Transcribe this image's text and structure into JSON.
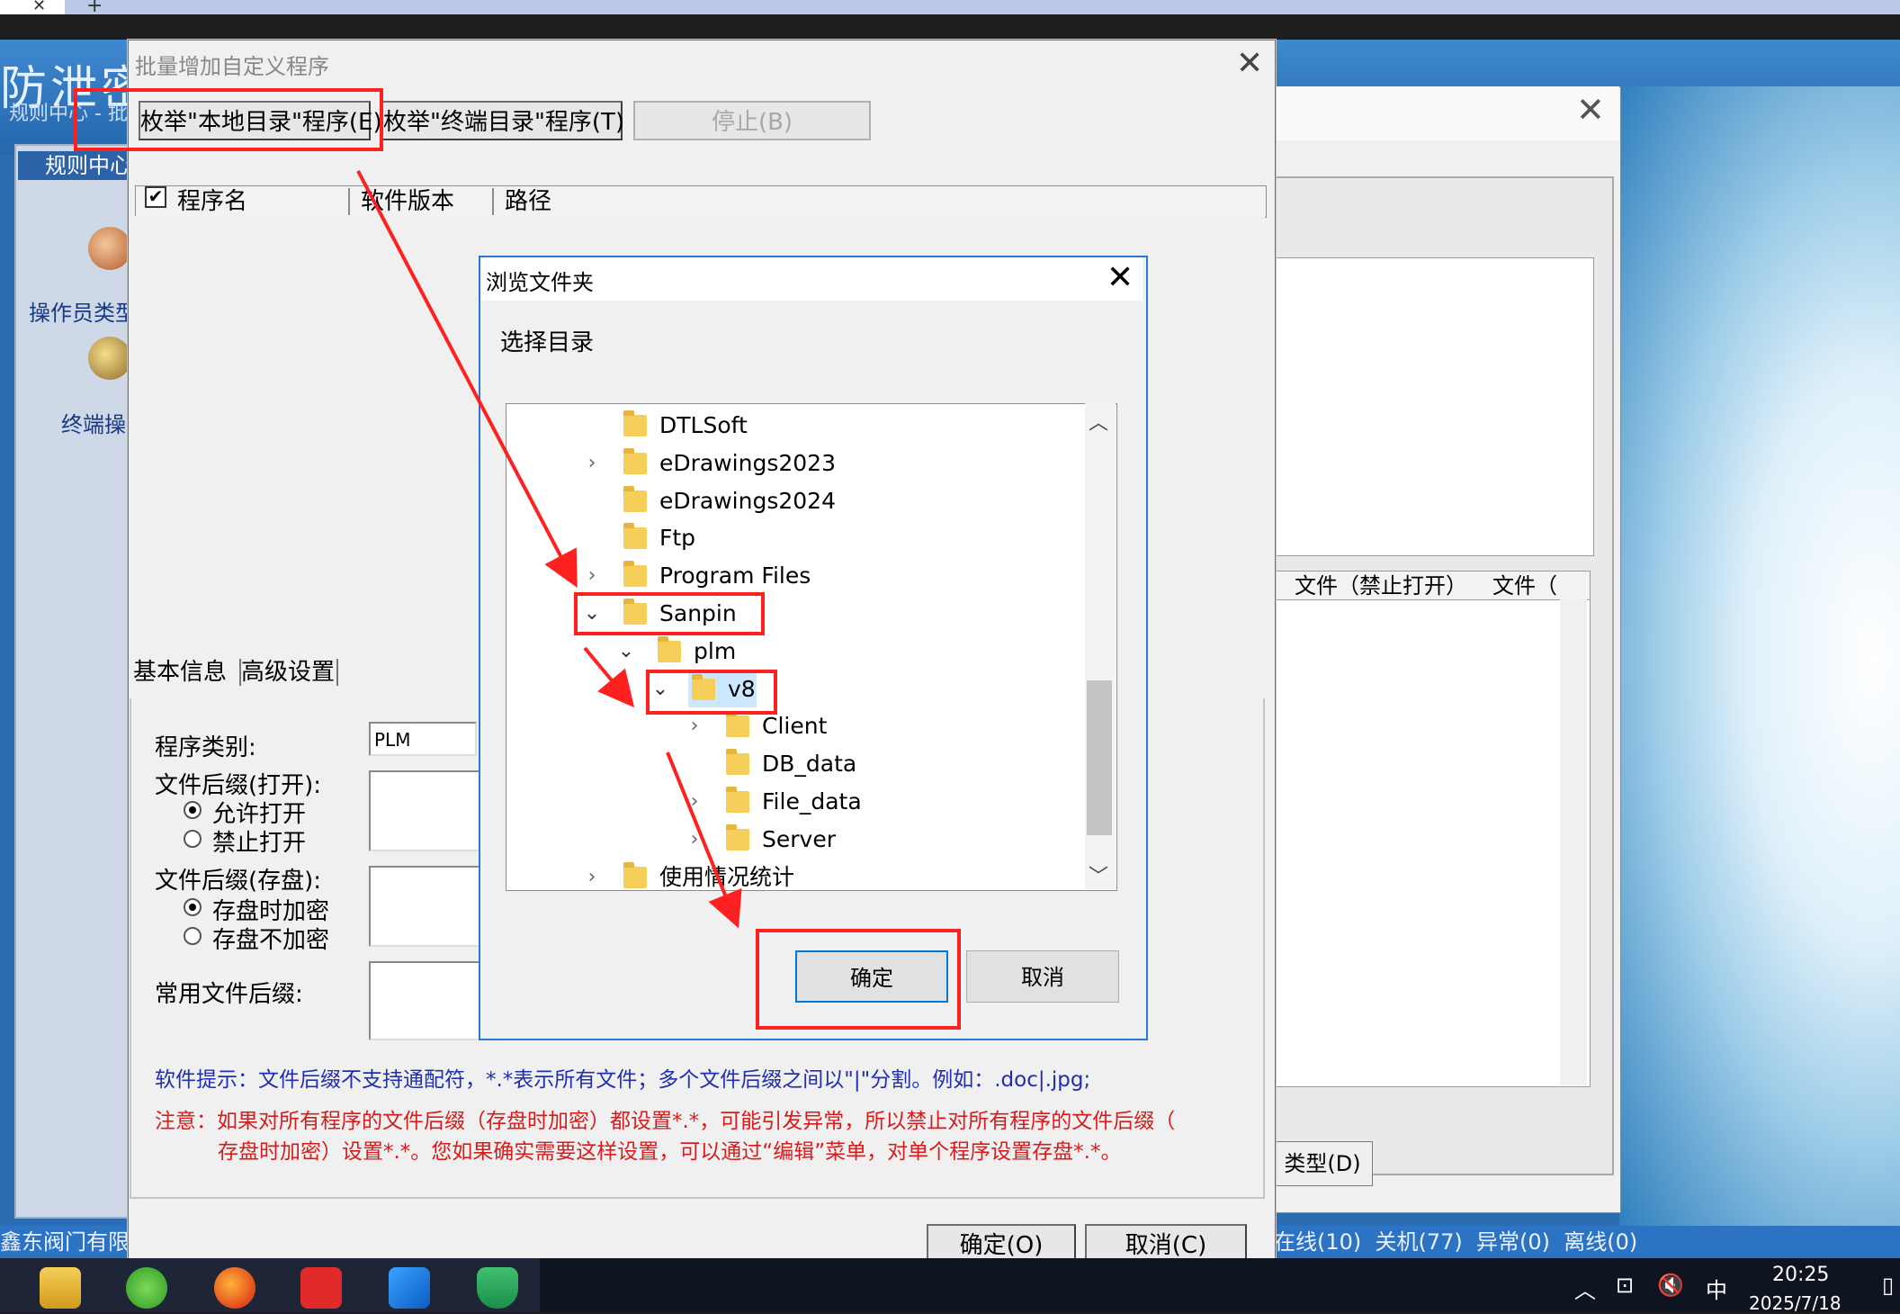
{
  "browser": {
    "new_tab_glyph": "+",
    "close_glyph": "✕"
  },
  "remote": {
    "brand": "防泄密",
    "left_subtitle": "规则中心 - 批",
    "left_panel_title": "规则中心",
    "side_items": [
      {
        "label": "操作员类型",
        "icon": "operator-type-icon"
      },
      {
        "label": "终端操作",
        "icon": "terminal-op-icon"
      }
    ],
    "right_window": {
      "headers": [
        "文件（禁止打开）",
        "文件（"
      ],
      "type_button": "类型(D)"
    },
    "status_left": "鑫东阀门有限",
    "status_right": "在线(10)  关机(77)  异常(0)  离线(0)"
  },
  "dialog": {
    "title": "批量增加自定义程序",
    "buttons": {
      "enum_local": "枚举\"本地目录\"程序(E)",
      "enum_terminal": "枚举\"终端目录\"程序(T)",
      "stop": "停止(B)"
    },
    "columns": [
      "程序名",
      "软件版本",
      "路径"
    ],
    "header_checkbox": "✔",
    "tabs": [
      "基本信息",
      "高级设置"
    ],
    "form": {
      "program_type_label": "程序类别:",
      "program_type_value": "PLM",
      "suffix_open_label": "文件后缀(打开):",
      "allow_open": "允许打开",
      "forbid_open": "禁止打开",
      "suffix_save_label": "文件后缀(存盘):",
      "encrypt_on_save": "存盘时加密",
      "no_encrypt": "存盘不加密",
      "common_suffix_label": "常用文件后缀:"
    },
    "hint": "软件提示：文件后缀不支持通配符，*.*表示所有文件；多个文件后缀之间以\"|\"分割。例如：.doc|.jpg;",
    "note_line1": "注意：如果对所有程序的文件后缀（存盘时加密）都设置*.*，可能引发异常，所以禁止对所有程序的文件后缀（",
    "note_line2": "存盘时加密）设置*.*。您如果确实需要这样设置，可以通过“编辑”菜单，对单个程序设置存盘*.*。",
    "ok": "确定(O)",
    "cancel": "取消(C)"
  },
  "folder_browser": {
    "title": "浏览文件夹",
    "prompt": "选择目录",
    "tree": [
      {
        "name": "DTLSoft",
        "level": 0,
        "expander": ""
      },
      {
        "name": "eDrawings2023",
        "level": 0,
        "expander": "›"
      },
      {
        "name": "eDrawings2024",
        "level": 0,
        "expander": ""
      },
      {
        "name": "Ftp",
        "level": 0,
        "expander": ""
      },
      {
        "name": "Program Files",
        "level": 0,
        "expander": "›"
      },
      {
        "name": "Sanpin",
        "level": 0,
        "expander": "⌄"
      },
      {
        "name": "plm",
        "level": 1,
        "expander": "⌄"
      },
      {
        "name": "v8",
        "level": 2,
        "expander": "⌄"
      },
      {
        "name": "Client",
        "level": 3,
        "expander": "›"
      },
      {
        "name": "DB_data",
        "level": 3,
        "expander": ""
      },
      {
        "name": "File_data",
        "level": 3,
        "expander": "›"
      },
      {
        "name": "Server",
        "level": 3,
        "expander": "›"
      },
      {
        "name": "使用情况统计",
        "level": 0,
        "expander": "›"
      }
    ],
    "selected": "v8",
    "ok": "确定",
    "cancel": "取消"
  },
  "taskbar": {
    "apps": [
      "file-explorer-icon",
      "browser-e-icon",
      "firefox-icon",
      "wps-icon",
      "remote-app-icon",
      "security-shield-icon"
    ],
    "ime": "中",
    "time": "20:25",
    "date": "2025/7/18"
  },
  "colors": {
    "annotation": "#ff2020",
    "dialog_border": "#2b78d4",
    "selection": "#cce8ff"
  }
}
